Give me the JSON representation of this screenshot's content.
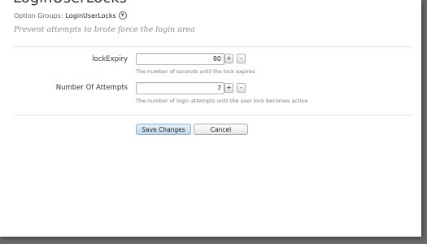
{
  "header": {
    "title": "LoginUserLocks",
    "option_groups_label": "Option Groups:",
    "option_group_name": "LoginUserLocks",
    "dropdown_icon": "chevron-down-circle-icon",
    "description": "Prevent attempts to brute force the login area"
  },
  "fields": [
    {
      "label": "lockExpiry",
      "value": "80",
      "hint": "The number of seconds until the lock expires",
      "increment_label": "+",
      "decrement_label": "-"
    },
    {
      "label": "Number Of Attempts",
      "value": "7",
      "hint": "The number of login attempts until the user lock becomes active",
      "increment_label": "+",
      "decrement_label": "-"
    }
  ],
  "actions": {
    "save_label": "Save Changes",
    "cancel_label": "Cancel"
  },
  "colors": {
    "backdrop": "#6b6b6b",
    "panel": "#ffffff",
    "save_button": "#bcd7ea"
  }
}
